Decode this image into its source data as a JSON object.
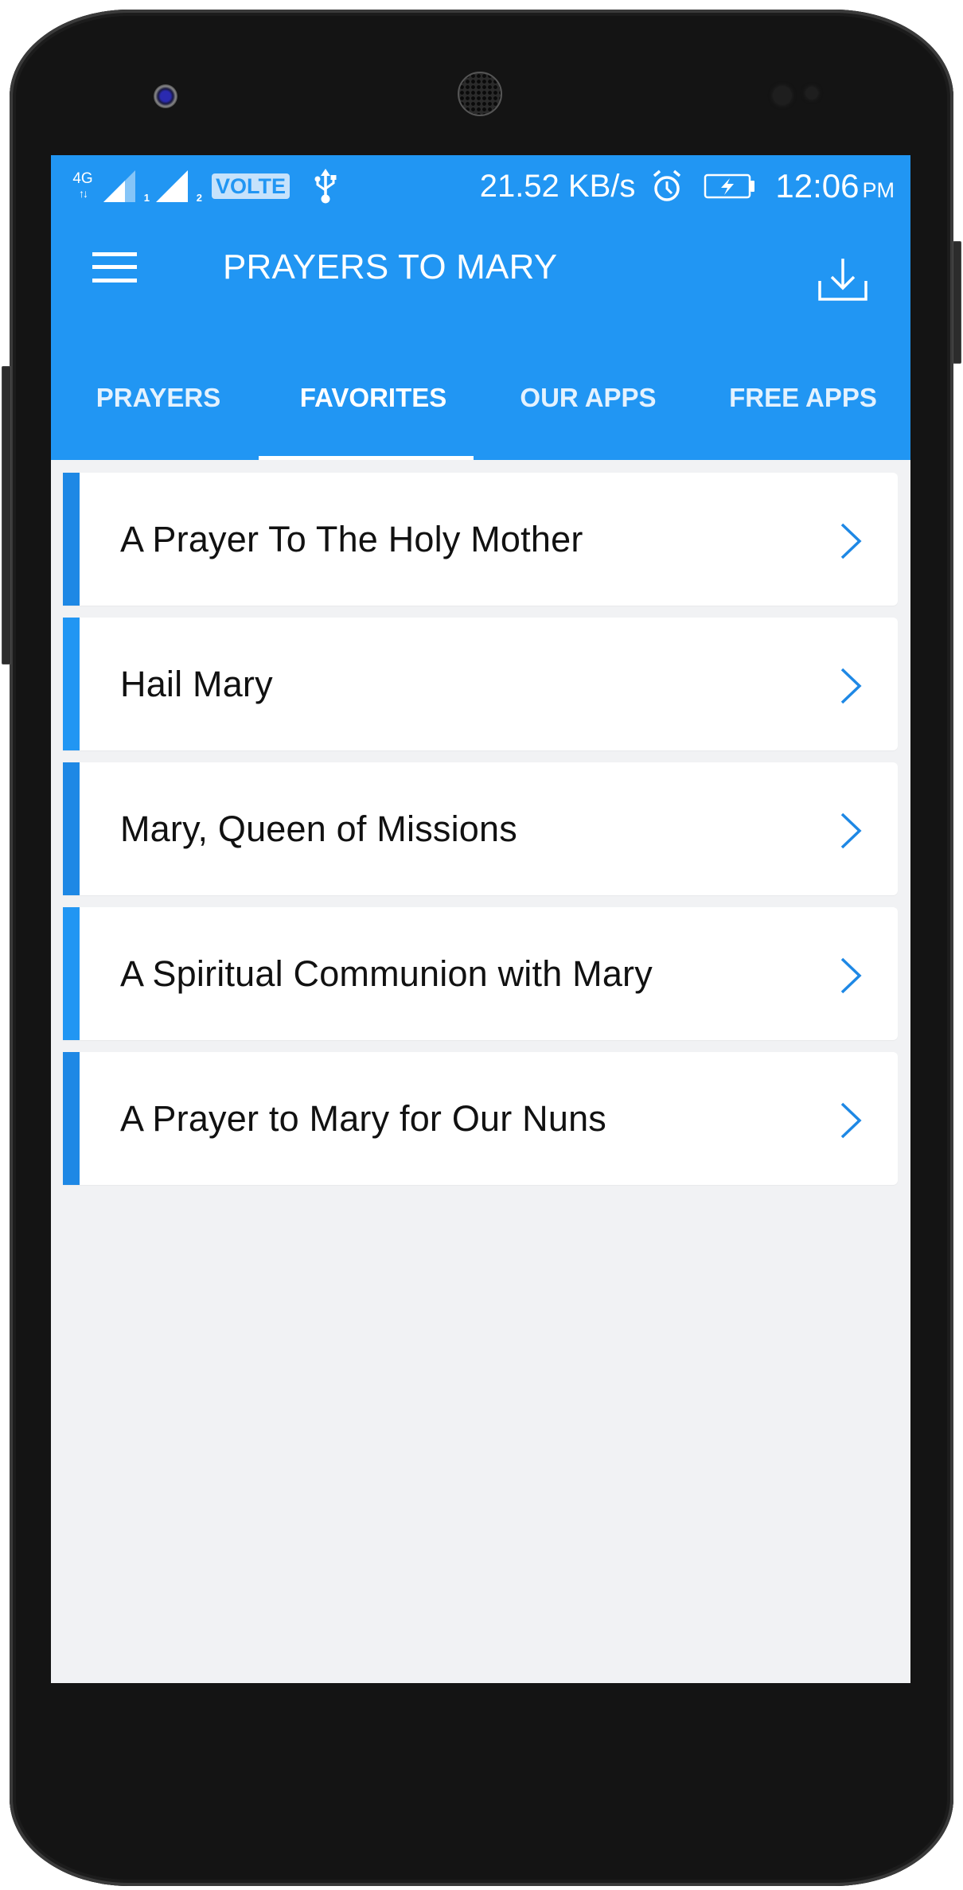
{
  "status_bar": {
    "network_type": "4G",
    "sim1_label": "1",
    "sim2_label": "2",
    "volte_label": "VOLTE",
    "net_speed": "21.52 KB/s",
    "time": "12:06",
    "ampm": "PM",
    "icons": [
      "data-arrows-icon",
      "signal-sim1-icon",
      "signal-sim2-icon",
      "volte-badge",
      "usb-icon",
      "alarm-icon",
      "battery-charging-icon"
    ]
  },
  "toolbar": {
    "menu_icon": "hamburger-menu-icon",
    "title": "PRAYERS TO MARY",
    "action_icon": "download-icon"
  },
  "tabs": [
    {
      "label": "PRAYERS",
      "active": false
    },
    {
      "label": "FAVORITES",
      "active": true
    },
    {
      "label": "OUR APPS",
      "active": false
    },
    {
      "label": "FREE APPS",
      "active": false
    }
  ],
  "favorites": [
    {
      "title": "A Prayer To The Holy Mother"
    },
    {
      "title": "Hail Mary"
    },
    {
      "title": "Mary, Queen of Missions"
    },
    {
      "title": "A Spiritual Communion with Mary"
    },
    {
      "title": "A Prayer to Mary for Our Nuns"
    }
  ],
  "colors": {
    "primary": "#2196F3",
    "accent_dark": "#1E88E5",
    "background": "#F1F2F4",
    "card": "#FFFFFF",
    "text": "#111111"
  }
}
